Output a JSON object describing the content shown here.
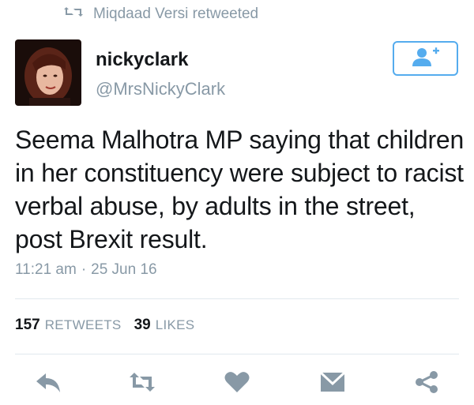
{
  "retweet_context": {
    "text": "Miqdaad Versi retweeted",
    "icon": "retweet-icon"
  },
  "author": {
    "name": "nickyclark",
    "handle": "@MrsNickyClark"
  },
  "follow_button": {
    "icon": "add-user-icon"
  },
  "tweet": {
    "text": "Seema Malhotra MP saying that children in her constituency were subject to racist verbal abuse, by adults in the street, post Brexit result.",
    "time": "11:21 am",
    "separator": "·",
    "date": "25 Jun 16"
  },
  "stats": {
    "retweets_count": "157",
    "retweets_label": "RETWEETS",
    "likes_count": "39",
    "likes_label": "LIKES"
  },
  "actions": [
    "reply-icon",
    "retweet-icon",
    "like-icon",
    "message-icon",
    "share-icon"
  ],
  "colors": {
    "accent": "#55acee",
    "icon_gray": "#8899a6",
    "divider": "#e1e8ed"
  }
}
